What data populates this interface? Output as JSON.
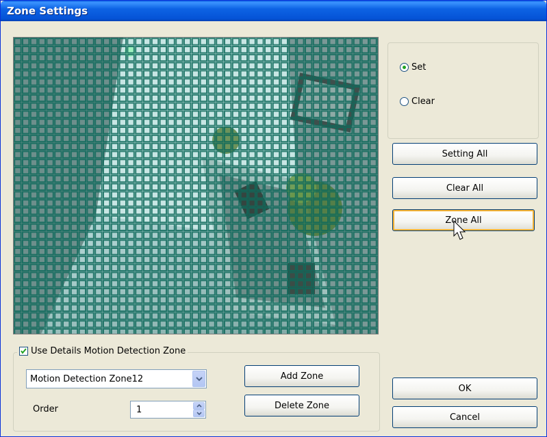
{
  "window": {
    "title": "Zone Settings"
  },
  "camera": {
    "description_icon": "camera-preview-grid",
    "grid_color": "#0f6a5c"
  },
  "mode": {
    "set_label": "Set",
    "clear_label": "Clear",
    "selected": "Set"
  },
  "buttons": {
    "setting_all": "Setting All",
    "clear_all": "Clear All",
    "zone_all": "Zone All",
    "add_zone": "Add Zone",
    "delete_zone": "Delete Zone",
    "ok": "OK",
    "cancel": "Cancel"
  },
  "details": {
    "checkbox_label": "Use Details Motion Detection Zone",
    "checked": true,
    "zone_select_value": "Motion Detection Zone12",
    "order_label": "Order",
    "order_value": "1"
  },
  "colors": {
    "title_bar": "#0553d6",
    "dialog_bg": "#ece9d8",
    "radio_dot": "#21a121",
    "hover_border": "#f8b536"
  }
}
